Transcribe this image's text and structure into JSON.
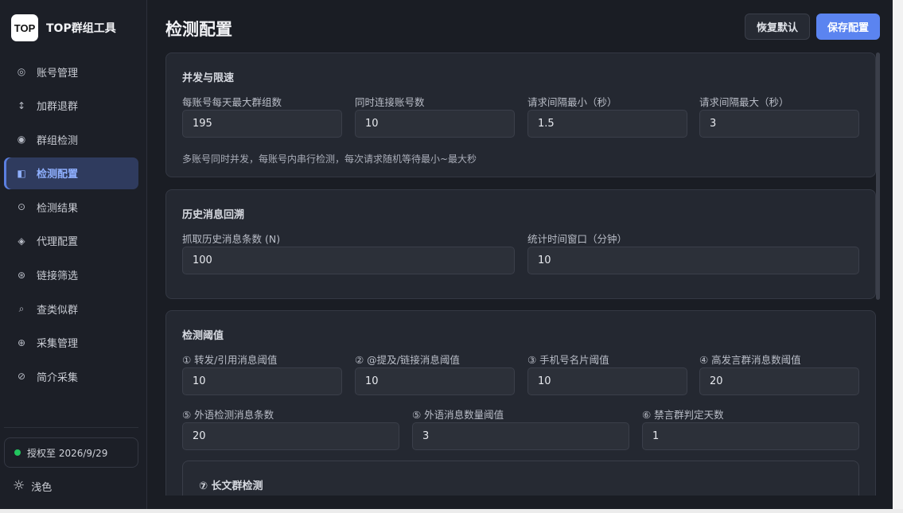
{
  "brand": {
    "logo_text": "TOP",
    "name": "TOP群组工具"
  },
  "nav": {
    "items": [
      {
        "icon": "◎",
        "icon_name": "account-icon",
        "label": "账号管理"
      },
      {
        "icon": "↕",
        "icon_name": "join-leave-icon",
        "label": "加群退群"
      },
      {
        "icon": "◉",
        "icon_name": "radio-icon",
        "label": "群组检测"
      },
      {
        "icon": "◧",
        "icon_name": "config-icon",
        "label": "检测配置",
        "active": true
      },
      {
        "icon": "⊙",
        "icon_name": "result-icon",
        "label": "检测结果"
      },
      {
        "icon": "◈",
        "icon_name": "proxy-icon",
        "label": "代理配置"
      },
      {
        "icon": "⊛",
        "icon_name": "link-filter-icon",
        "label": "链接筛选"
      },
      {
        "icon": "⌕",
        "icon_name": "search-icon",
        "label": "查类似群"
      },
      {
        "icon": "⊕",
        "icon_name": "collect-icon",
        "label": "采集管理"
      },
      {
        "icon": "⊘",
        "icon_name": "bio-collect-icon",
        "label": "简介采集"
      }
    ]
  },
  "license": {
    "text": "授权至 2026/9/29",
    "status_color": "#22c55e"
  },
  "theme": {
    "icon": "☼",
    "label": "浅色"
  },
  "header": {
    "title": "检测配置",
    "reset_label": "恢复默认",
    "save_label": "保存配置"
  },
  "concurrency": {
    "title": "并发与限速",
    "fields": [
      {
        "label": "每账号每天最大群组数",
        "value": "195"
      },
      {
        "label": "同时连接账号数",
        "value": "10"
      },
      {
        "label": "请求间隔最小（秒）",
        "value": "1.5"
      },
      {
        "label": "请求间隔最大（秒）",
        "value": "3"
      }
    ],
    "hint": "多账号同时并发，每账号内串行检测，每次请求随机等待最小~最大秒"
  },
  "history": {
    "title": "历史消息回溯",
    "fields": [
      {
        "label": "抓取历史消息条数 (N)",
        "value": "100"
      },
      {
        "label": "统计时间窗口（分钟）",
        "value": "10"
      }
    ]
  },
  "thresholds": {
    "title": "检测阈值",
    "row1": [
      {
        "label": "① 转发/引用消息阈值",
        "value": "10"
      },
      {
        "label": "② @提及/链接消息阈值",
        "value": "10"
      },
      {
        "label": "③ 手机号名片阈值",
        "value": "10"
      },
      {
        "label": "④ 高发言群消息数阈值",
        "value": "20"
      }
    ],
    "row2": [
      {
        "label": "⑤ 外语检测消息条数",
        "value": "20"
      },
      {
        "label": "⑤ 外语消息数量阈值",
        "value": "3"
      },
      {
        "label": "⑥ 禁言群判定天数",
        "value": "1"
      }
    ],
    "long_text_title": "⑦ 长文群检测"
  },
  "colors": {
    "accent": "#5b84f0",
    "active_nav_bg": "#2f3b5e",
    "active_nav_text": "#8fb0ff"
  }
}
